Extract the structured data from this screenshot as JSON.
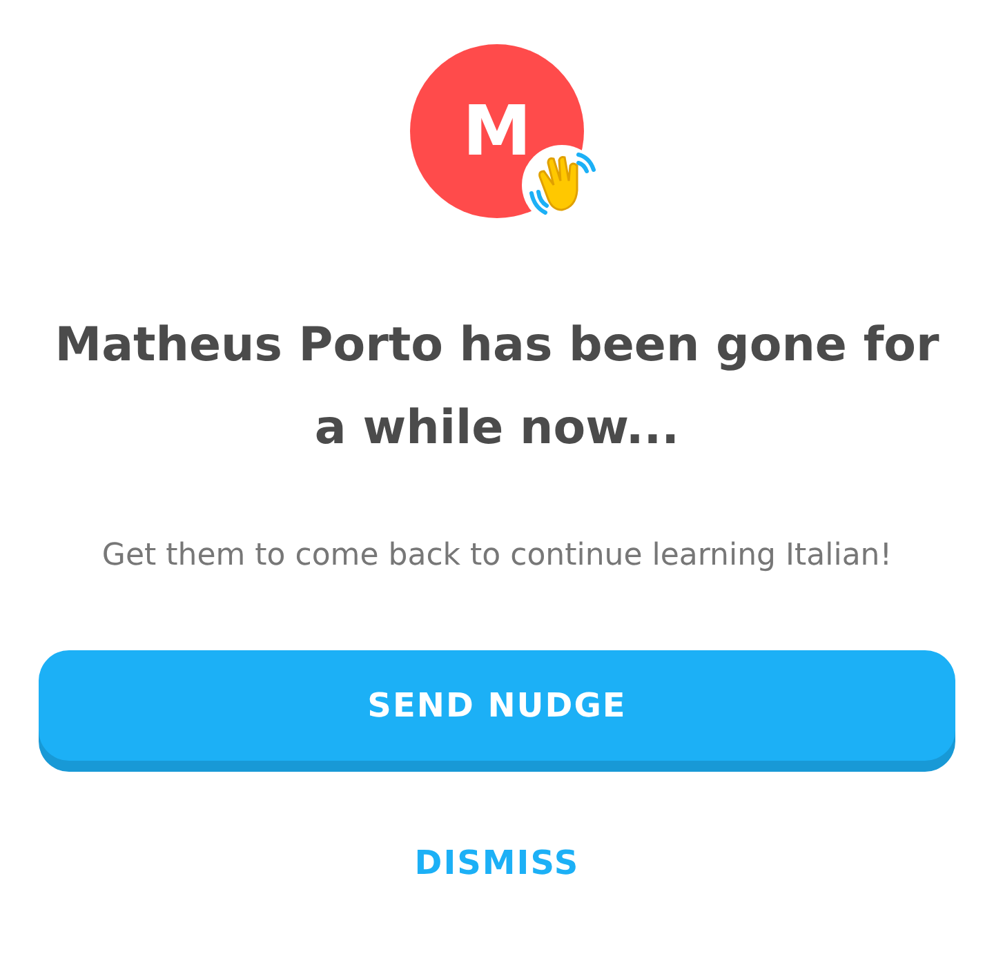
{
  "avatar": {
    "letter": "M",
    "color": "#ff4b4b"
  },
  "title": "Matheus Porto has been gone for a while now...",
  "message": "Get them to come back to continue learning Italian!",
  "primary_button": "SEND NUDGE",
  "secondary_button": "DISMISS"
}
